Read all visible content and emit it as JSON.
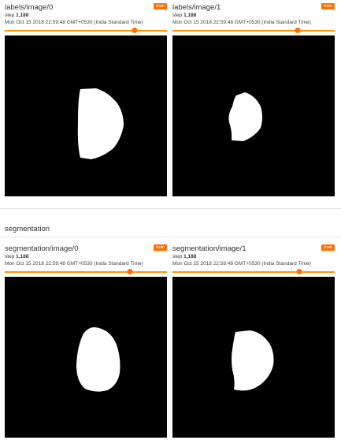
{
  "cards_top": [
    {
      "title": "labels/image/0",
      "run": "train",
      "step_label": "step",
      "step_value": "1,188",
      "timestamp": "Mon Oct 15 2018 22:59:48 GMT+0530 (India Standard Time)",
      "slider_level_pct": 80
    },
    {
      "title": "labels/image/1",
      "run": "train",
      "step_label": "step",
      "step_value": "1,188",
      "timestamp": "Mon Oct 15 2018 22:59:48 GMT+0530 (India Standard Time)",
      "slider_level_pct": 77
    }
  ],
  "section": {
    "title": "segmentation"
  },
  "cards_bottom": [
    {
      "title": "segmentation/image/0",
      "run": "train",
      "step_label": "step",
      "step_value": "1,188",
      "timestamp": "Mon Oct 15 2018 22:59:48 GMT+0530 (India Standard Time)",
      "slider_level_pct": 77
    },
    {
      "title": "segmentation/image/1",
      "run": "train",
      "step_label": "step",
      "step_value": "1,188",
      "timestamp": "Mon Oct 15 2018 22:59:48 GMT+0530 (India Standard Time)",
      "slider_level_pct": 78
    }
  ],
  "colors": {
    "run_badge": "#ff6f00",
    "slider": "#ff9800",
    "image_background": "#000000",
    "mask": "#ffffff"
  }
}
